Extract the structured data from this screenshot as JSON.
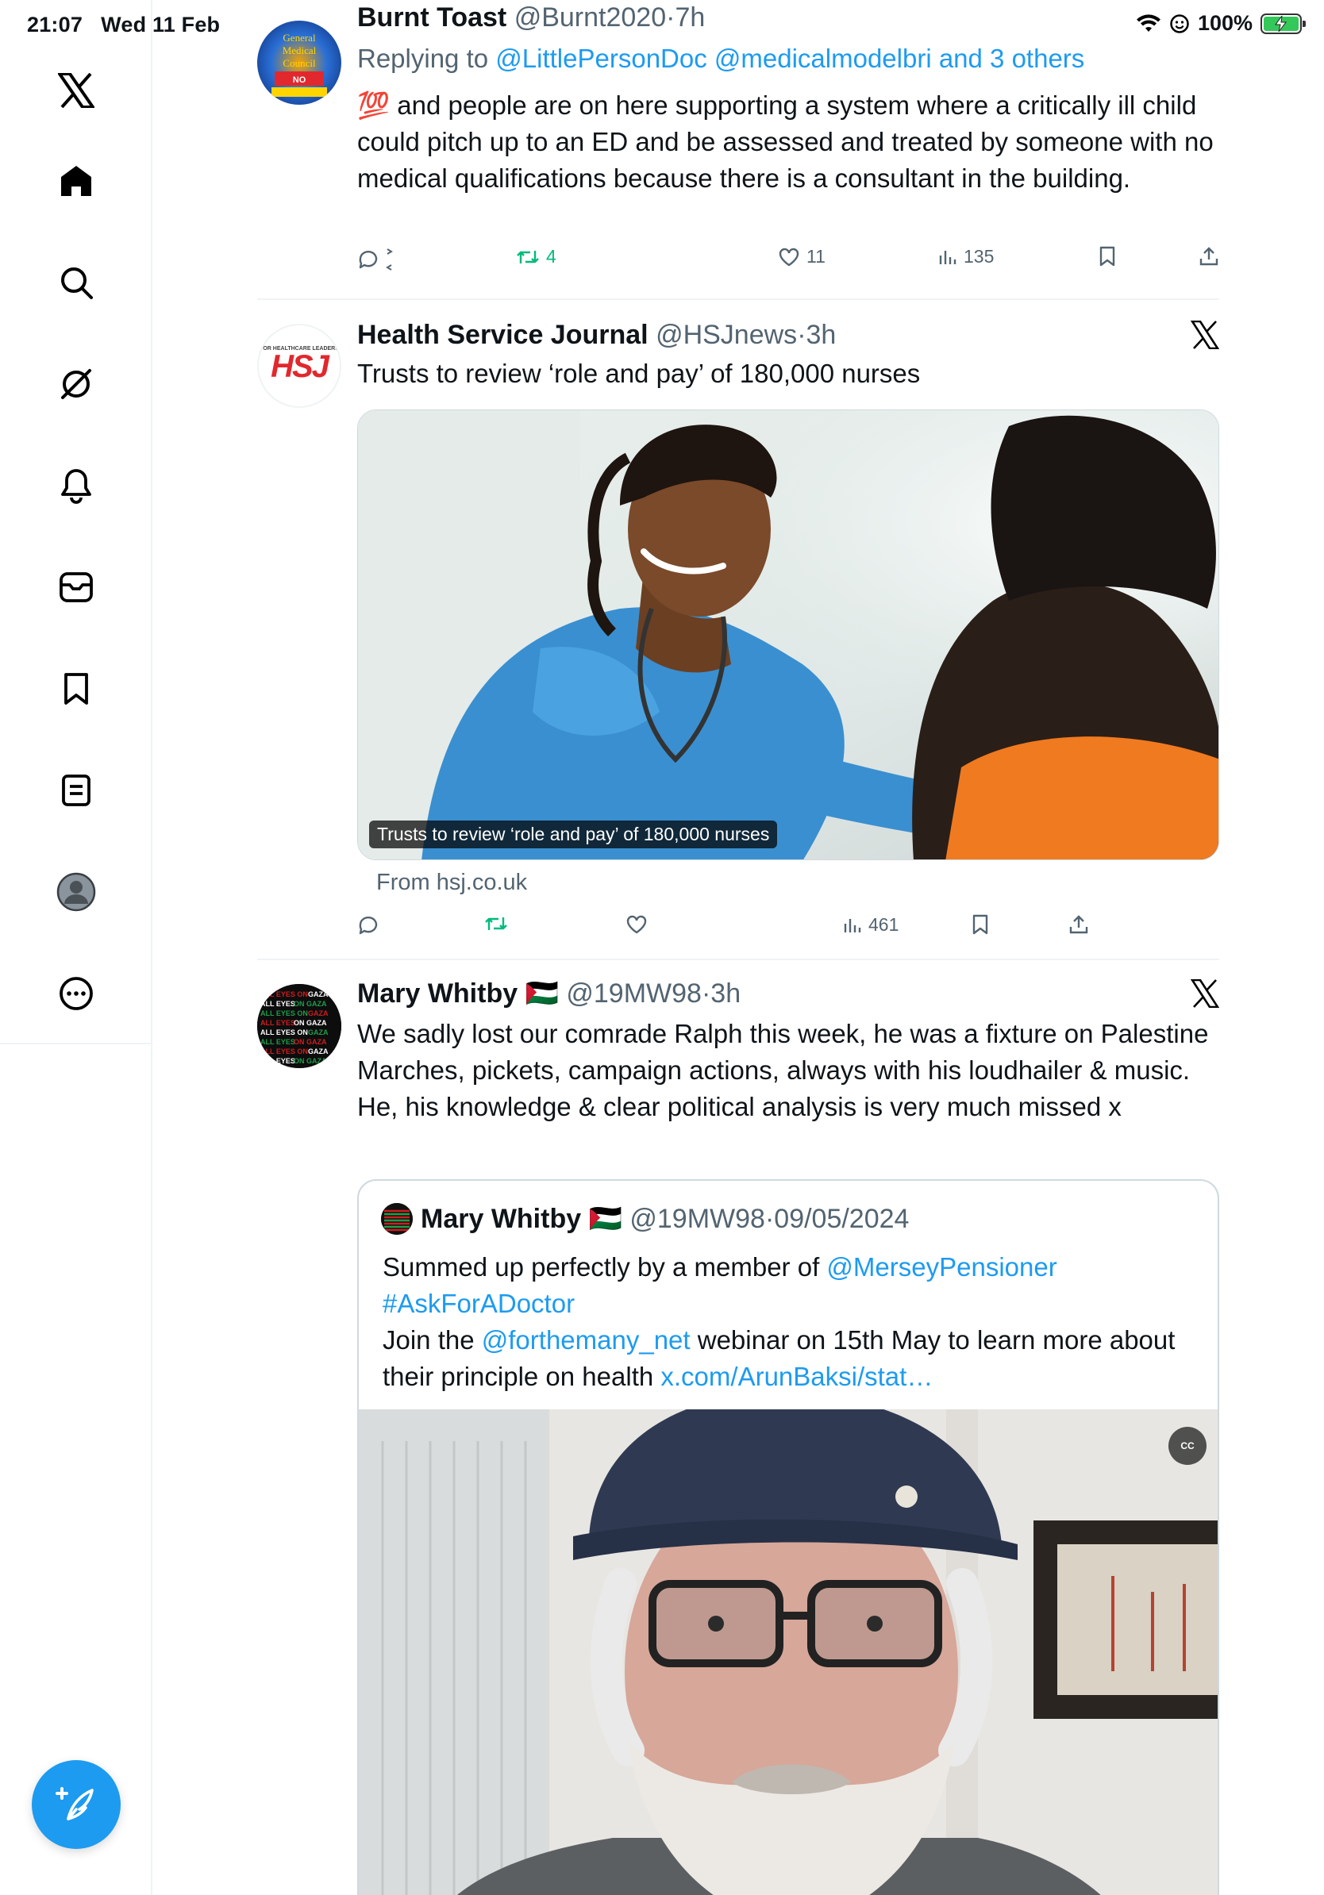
{
  "status": {
    "time": "21:07",
    "date": "Wed 11 Feb",
    "battery": "100%"
  },
  "sidebar": {
    "items": [
      {
        "icon": "x-logo-icon"
      },
      {
        "icon": "home-icon"
      },
      {
        "icon": "search-icon"
      },
      {
        "icon": "grok-icon"
      },
      {
        "icon": "notifications-bell-icon"
      },
      {
        "icon": "messages-icon"
      },
      {
        "icon": "bookmark-icon"
      },
      {
        "icon": "lists-icon"
      },
      {
        "icon": "profile-avatar-icon"
      },
      {
        "icon": "more-icon"
      }
    ],
    "compose_icon": "compose-post-icon"
  },
  "feed": {
    "tweets": [
      {
        "name": "Burnt Toast",
        "handle": "@Burnt2020",
        "time": "7h",
        "replying_prefix": "Replying to",
        "replying_to": "@LittlePersonDoc @medicalmodelbri and 3 others",
        "emoji": "💯",
        "text": "and people are on here supporting a system where a critically ill child could pitch up to an ED and be assessed and treated by someone with no medical qualifications because there is a consultant in the building.",
        "retweets": "4",
        "likes": "11",
        "views": "135"
      },
      {
        "name": "Health Service Journal",
        "handle": "@HSJnews",
        "time": "3h",
        "text": "Trusts to review ‘role and pay’ of 180,000 nurses",
        "card_caption": "Trusts to review ‘role and pay’ of 180,000 nurses",
        "card_source": "From hsj.co.uk",
        "avatar_text": "HSJ",
        "avatar_small": "FOR HEALTHCARE LEADERS",
        "views": "461"
      },
      {
        "name": "Mary Whitby",
        "flag": "🇵🇸",
        "handle": "@19MW98",
        "time": "3h",
        "text": "We sadly lost our comrade Ralph this week, he was a fixture on Palestine Marches, pickets, campaign actions, always with his loudhailer & music. He, his knowledge & clear political analysis is very much missed x",
        "quote": {
          "name": "Mary Whitby",
          "flag": "🇵🇸",
          "handle": "@19MW98",
          "date": "09/05/2024",
          "line1_prefix": "Summed up perfectly by a member of",
          "mention1": "@MerseyPensioner",
          "hashtag": "#AskForADoctor",
          "line3_prefix": "Join the",
          "mention2": "@forthemany_net",
          "line3_suffix": "webinar on 15th May to learn more about",
          "line4_prefix": "their principle on health",
          "url": "x.com/ArunBaksi/stat…",
          "cc": "CC"
        }
      }
    ]
  },
  "colors": {
    "accent": "#1d9bf0",
    "retweet": "#00ba7c",
    "muted": "#536471"
  }
}
